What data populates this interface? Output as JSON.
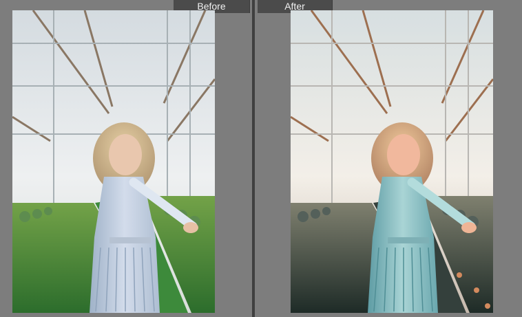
{
  "compare": {
    "before_label": "Before",
    "after_label": "After"
  },
  "colors": {
    "background": "#7b7b7b",
    "label_bg": "#4b4b4b",
    "label_text": "#f1f1f1",
    "before_accent": "#2f7d2f",
    "after_accent": "#3b4d46"
  }
}
